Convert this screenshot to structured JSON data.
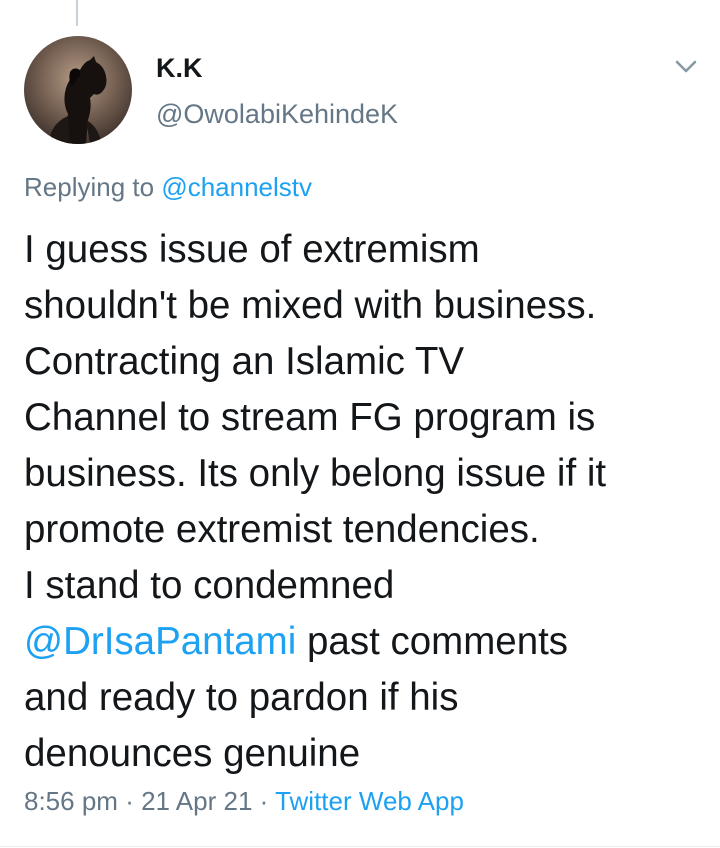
{
  "tweet": {
    "author": {
      "display_name": "K.K",
      "handle": "@OwolabiKehindeK",
      "avatar_icon": "horse-avatar"
    },
    "menu_icon": "chevron-down-icon",
    "replying_prefix": "Replying to",
    "replying_to": "@channelstv",
    "body_lines": [
      "I guess issue of extremism",
      "shouldn't be mixed with business.",
      "Contracting an Islamic TV",
      "Channel to stream FG program is",
      "business. Its only belong issue if it",
      "promote extremist tendencies.",
      "I stand to condemned",
      "",
      "and ready to pardon if his",
      "denounces genuine"
    ],
    "body_mention": "@DrIsaPantami",
    "body_after_mention": " past comments",
    "time": "8:56 pm",
    "date": "21 Apr 21",
    "separator": "·",
    "source": "Twitter Web App"
  },
  "colors": {
    "link": "#1da1f2",
    "secondary_text": "#657786",
    "primary_text": "#14171a"
  }
}
